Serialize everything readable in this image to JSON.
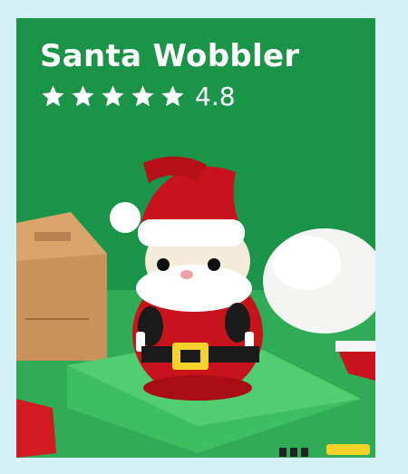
{
  "product": {
    "title": "Santa Wobbler",
    "rating_value": "4.8",
    "star_count": 5,
    "colors": {
      "background": "#d4f1f7",
      "card": "#1a9448",
      "santa_red": "#c8131c",
      "buckle_yellow": "#f3d22a"
    }
  }
}
